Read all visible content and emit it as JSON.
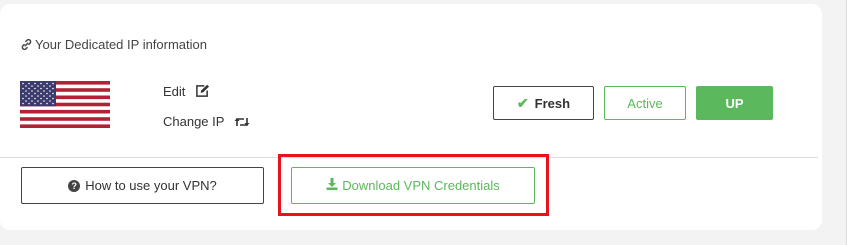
{
  "info": {
    "title": "Your Dedicated IP information",
    "link_icon": "link-icon"
  },
  "flag": {
    "country": "us-flag-icon"
  },
  "actions": {
    "edit_label": "Edit",
    "edit_icon": "edit-icon",
    "change_ip_label": "Change IP",
    "change_ip_icon": "retweet-icon"
  },
  "status": {
    "fresh_label": "Fresh",
    "fresh_icon": "check-icon",
    "active_label": "Active",
    "up_label": "UP"
  },
  "footer": {
    "how_to_label": "How to use your VPN?",
    "how_to_icon": "question-circle-icon",
    "download_label": "Download VPN Credentials",
    "download_icon": "download-icon"
  },
  "colors": {
    "green": "#5cb85c",
    "highlight_red": "#e8121c"
  }
}
